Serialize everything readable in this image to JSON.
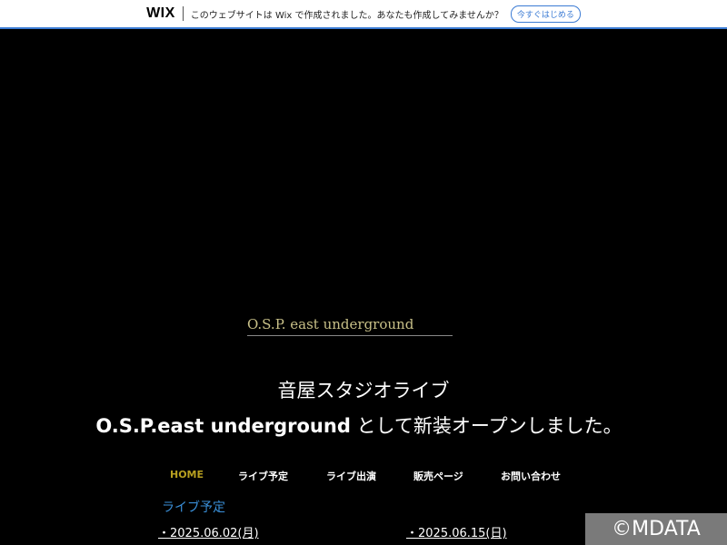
{
  "wix_banner": {
    "logo": "WIX",
    "message": "このウェブサイトは Wix で作成されました。あなたも作成してみませんか？",
    "cta_label": "今すぐはじめる",
    "accent_color": "#3b7bd4"
  },
  "hero": {
    "brand": "O.S.P. east underground",
    "line1": "音屋スタジオライブ",
    "line2_bold": "O.S.P.east underground",
    "line2_rest": " として新装オープンしました。"
  },
  "nav": {
    "items": [
      {
        "label": "HOME",
        "active": true
      },
      {
        "label": "ライブ予定",
        "active": false
      },
      {
        "label": "ライブ出演",
        "active": false
      },
      {
        "label": "販売ページ",
        "active": false
      },
      {
        "label": "お問い合わせ",
        "active": false
      }
    ],
    "active_color": "#b8a020"
  },
  "schedule": {
    "title": "ライブ予定",
    "dates": [
      "・2025.06.02(月)",
      "・2025.06.15(日)"
    ]
  },
  "watermark": "©MDATA"
}
